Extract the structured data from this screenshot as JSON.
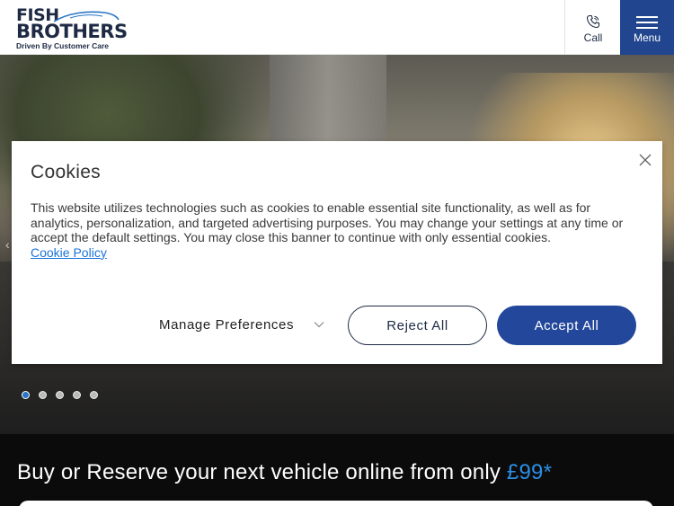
{
  "header": {
    "logo_line1": "FISH",
    "logo_line2": "BROTHERS",
    "logo_tagline": "Driven By Customer Care",
    "call_label": "Call",
    "menu_label": "Menu"
  },
  "hero": {
    "slide_count": 5,
    "active_slide": 1
  },
  "cookie_banner": {
    "title": "Cookies",
    "body": "This website utilizes technologies such as cookies to enable essential site functionality, as well as for analytics, personalization, and targeted advertising purposes. You may change your settings at any time or accept the default settings. You may close this banner to continue with only essential cookies.",
    "policy_link": "Cookie Policy",
    "manage_label": "Manage Preferences",
    "reject_label": "Reject All",
    "accept_label": "Accept All"
  },
  "promo": {
    "text": "Buy or Reserve your next vehicle online from only ",
    "price": "£99*"
  },
  "colors": {
    "brand_navy": "#1e2a44",
    "accent_blue": "#23479a",
    "link_blue": "#1a73d9",
    "price_blue": "#2c8fe6"
  }
}
